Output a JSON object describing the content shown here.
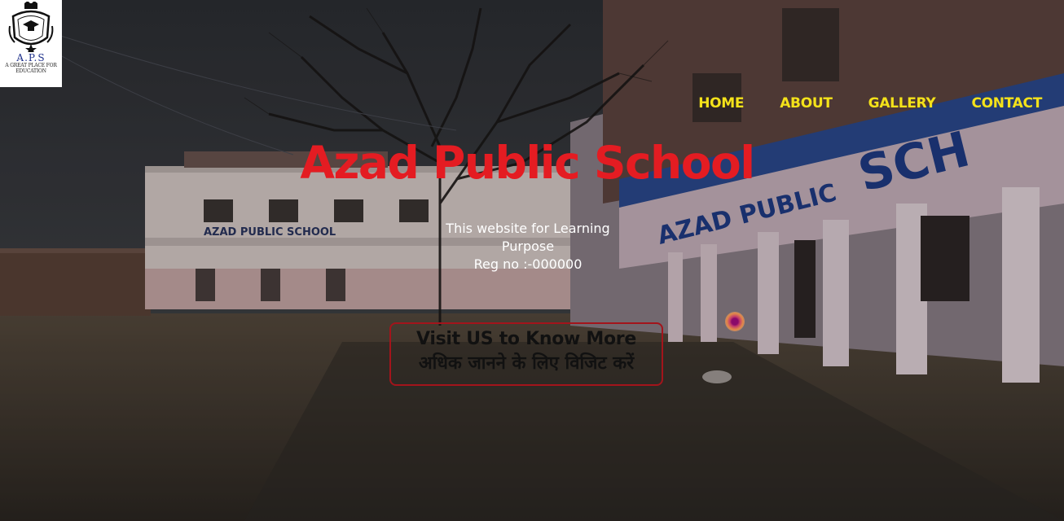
{
  "logo": {
    "abbr": "A.P.S",
    "tagline_line1": "A GREAT PLACE FOR",
    "tagline_line2": "EDUCATION"
  },
  "nav": {
    "items": [
      {
        "label": "HOME"
      },
      {
        "label": "ABOUT"
      },
      {
        "label": "GALLERY"
      },
      {
        "label": "CONTACT"
      }
    ]
  },
  "hero": {
    "title": "Azad Public School",
    "subtitle_line1": "This website for Learning",
    "subtitle_line2": "Purpose",
    "subtitle_line3": "Reg no :-000000",
    "cta_english": "Visit US to Know More",
    "cta_hindi": "अधिक जानने के लिए विजिट करें"
  },
  "colors": {
    "title": "#e41c22",
    "nav": "#f4e21a",
    "cta_border": "#a3141b"
  }
}
